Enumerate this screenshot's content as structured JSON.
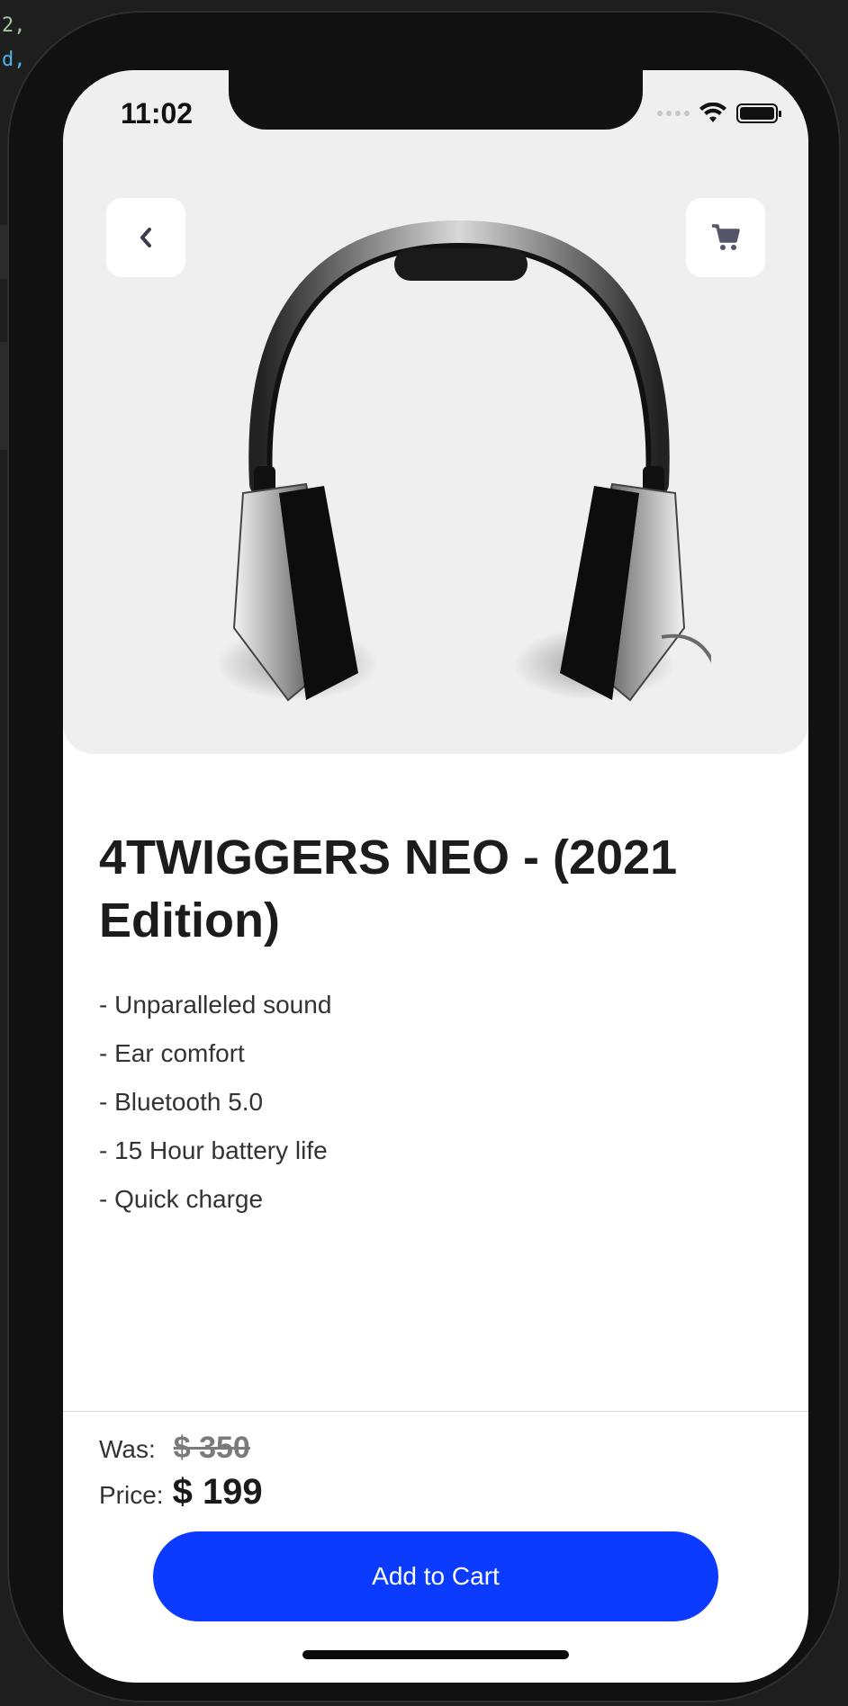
{
  "status_bar": {
    "time": "11:02"
  },
  "editor_fragments": [
    "2,",
    "d,"
  ],
  "nav": {
    "back_icon": "chevron-left-icon",
    "cart_icon": "shopping-cart-icon"
  },
  "product": {
    "title": "4TWIGGERS NEO - (2021 Edition)",
    "features": [
      "- Unparalleled sound",
      "- Ear comfort",
      "- Bluetooth 5.0",
      "- 15 Hour battery life",
      "- Quick charge"
    ]
  },
  "pricing": {
    "was_label": "Was:",
    "was_value": "$ 350",
    "price_label": "Price:",
    "price_value": "$ 199"
  },
  "cta": {
    "add_to_cart_label": "Add to Cart"
  },
  "colors": {
    "accent": "#0a3bff",
    "background": "#ffffff",
    "hero_background": "#efefef"
  }
}
